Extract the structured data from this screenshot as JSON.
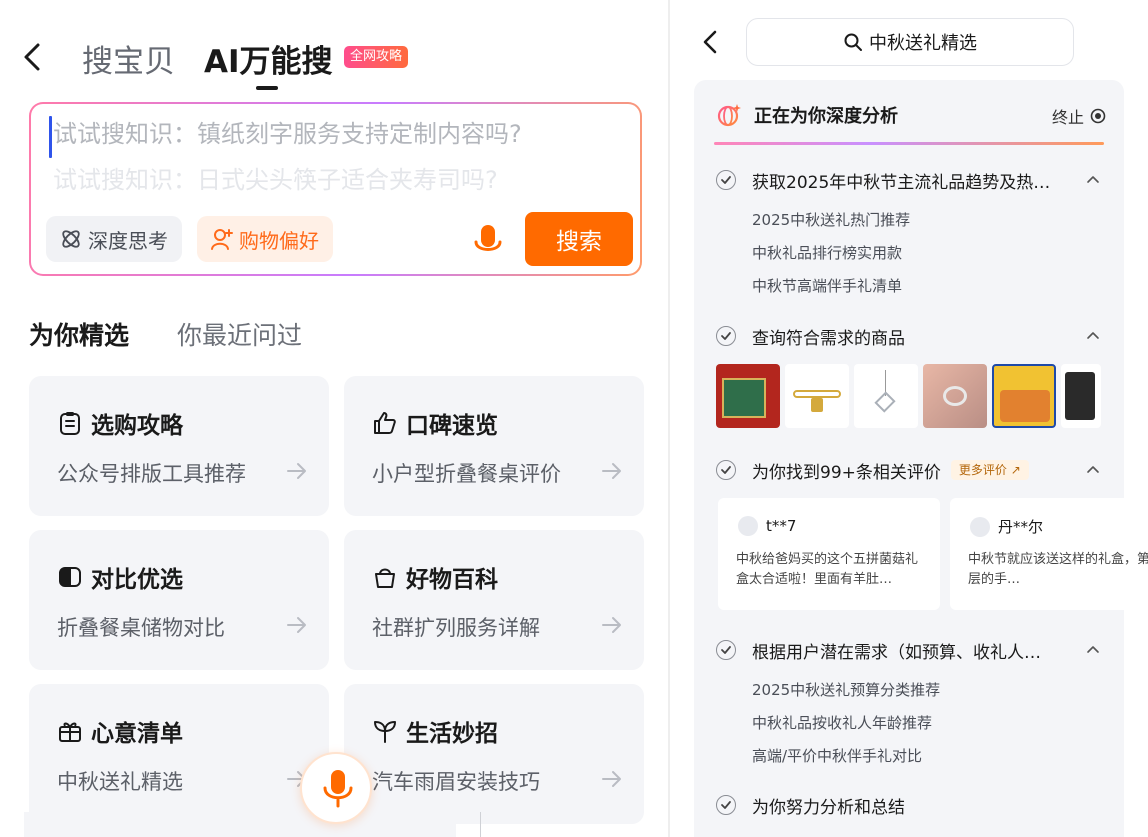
{
  "left": {
    "tabs": {
      "search_label": "搜宝贝",
      "ai_label": "AI万能搜",
      "ai_badge": "全网攻略"
    },
    "search": {
      "placeholder_1": "试试搜知识：镇纸刻字服务支持定制内容吗?",
      "placeholder_2": "试试搜知识：日式尖头筷子适合夹寿司吗?",
      "deep_think_label": "深度思考",
      "preference_label": "购物偏好",
      "search_button": "搜索"
    },
    "section_tabs": {
      "active": "为你精选",
      "inactive": "你最近问过"
    },
    "cards": [
      {
        "title": "选购攻略",
        "icon": "clipboard-icon",
        "sub": "公众号排版工具推荐"
      },
      {
        "title": "口碑速览",
        "icon": "thumbs-up-icon",
        "sub": "小户型折叠餐桌评价"
      },
      {
        "title": "对比优选",
        "icon": "compare-icon",
        "sub": "折叠餐桌储物对比"
      },
      {
        "title": "好物百科",
        "icon": "bag-icon",
        "sub": "社群扩列服务详解"
      },
      {
        "title": "心意清单",
        "icon": "gift-icon",
        "sub": "中秋送礼精选"
      },
      {
        "title": "生活妙招",
        "icon": "sprout-icon",
        "sub": "汽车雨眉安装技巧"
      }
    ]
  },
  "right": {
    "search_query": "中秋送礼精选",
    "status_title": "正在为你深度分析",
    "stop_label": "终止",
    "steps": [
      {
        "label": "获取2025年中秋节主流礼品趋势及热…",
        "subs": [
          "2025中秋送礼热门推荐",
          "中秋礼品排行榜实用款",
          "中秋节高端伴手礼清单"
        ]
      },
      {
        "label": "查询符合需求的商品"
      },
      {
        "label": "为你找到99+条相关评价",
        "more": "更多评价 ↗"
      },
      {
        "label": "根据用户潜在需求（如预算、收礼人…",
        "subs": [
          "2025中秋送礼预算分类推荐",
          "中秋礼品按收礼人年龄推荐",
          "高端/平价中秋伴手礼对比"
        ]
      },
      {
        "label": "为你努力分析和总结"
      }
    ],
    "reviews": [
      {
        "user": "t**7",
        "text": "中秋给爸妈买的这个五拼菌菇礼盒太合适啦！里面有羊肚…"
      },
      {
        "user": "丹**尔",
        "text": "中秋节就应该送这样的礼盒，第一层的手…"
      }
    ],
    "accent_color": "#ff6a00"
  }
}
